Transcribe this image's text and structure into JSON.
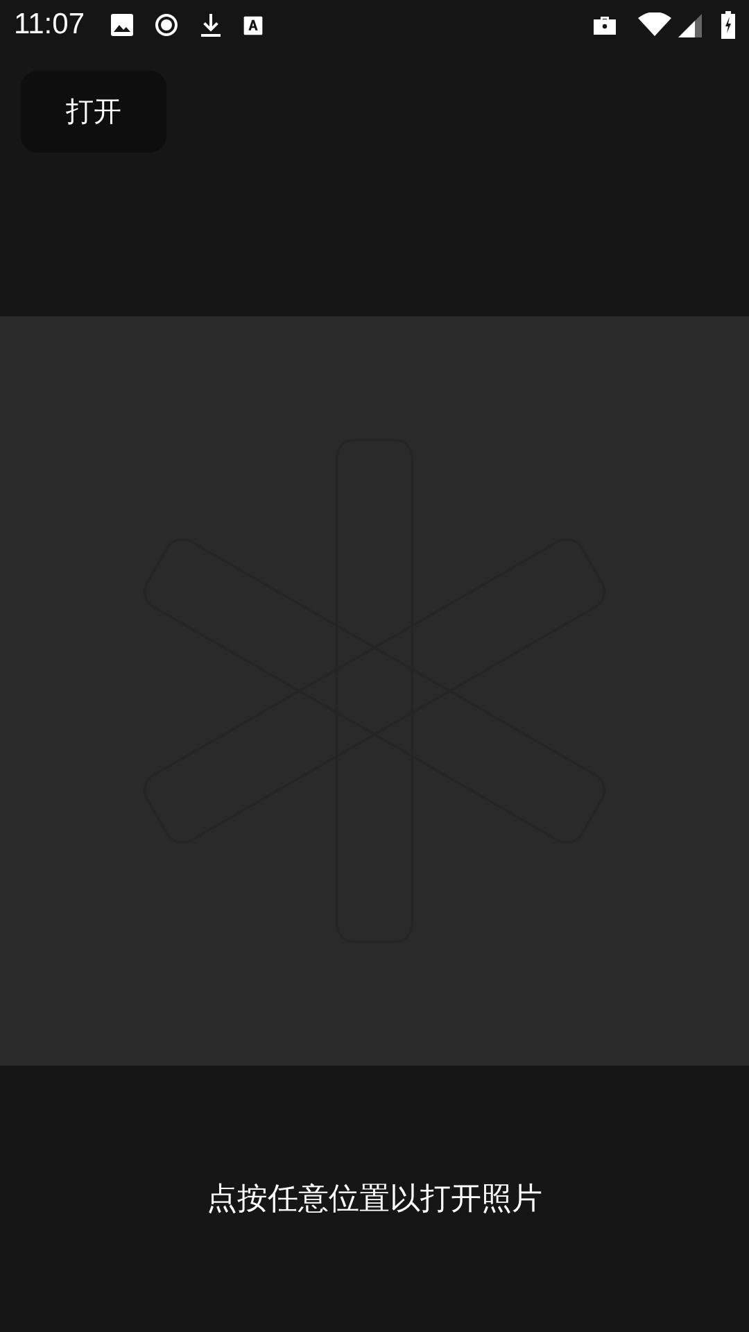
{
  "status_bar": {
    "time": "11:07"
  },
  "toolbar": {
    "open_button": "打开"
  },
  "viewer": {
    "hint": "点按任意位置以打开照片"
  }
}
